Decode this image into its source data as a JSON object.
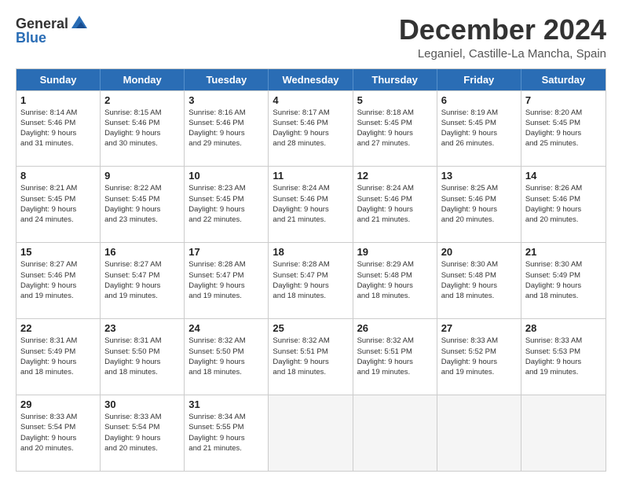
{
  "logo": {
    "general": "General",
    "blue": "Blue"
  },
  "title": "December 2024",
  "location": "Leganiel, Castille-La Mancha, Spain",
  "weekdays": [
    "Sunday",
    "Monday",
    "Tuesday",
    "Wednesday",
    "Thursday",
    "Friday",
    "Saturday"
  ],
  "weeks": [
    [
      {
        "day": "1",
        "info": "Sunrise: 8:14 AM\nSunset: 5:46 PM\nDaylight: 9 hours\nand 31 minutes."
      },
      {
        "day": "2",
        "info": "Sunrise: 8:15 AM\nSunset: 5:46 PM\nDaylight: 9 hours\nand 30 minutes."
      },
      {
        "day": "3",
        "info": "Sunrise: 8:16 AM\nSunset: 5:46 PM\nDaylight: 9 hours\nand 29 minutes."
      },
      {
        "day": "4",
        "info": "Sunrise: 8:17 AM\nSunset: 5:46 PM\nDaylight: 9 hours\nand 28 minutes."
      },
      {
        "day": "5",
        "info": "Sunrise: 8:18 AM\nSunset: 5:45 PM\nDaylight: 9 hours\nand 27 minutes."
      },
      {
        "day": "6",
        "info": "Sunrise: 8:19 AM\nSunset: 5:45 PM\nDaylight: 9 hours\nand 26 minutes."
      },
      {
        "day": "7",
        "info": "Sunrise: 8:20 AM\nSunset: 5:45 PM\nDaylight: 9 hours\nand 25 minutes."
      }
    ],
    [
      {
        "day": "8",
        "info": "Sunrise: 8:21 AM\nSunset: 5:45 PM\nDaylight: 9 hours\nand 24 minutes."
      },
      {
        "day": "9",
        "info": "Sunrise: 8:22 AM\nSunset: 5:45 PM\nDaylight: 9 hours\nand 23 minutes."
      },
      {
        "day": "10",
        "info": "Sunrise: 8:23 AM\nSunset: 5:45 PM\nDaylight: 9 hours\nand 22 minutes."
      },
      {
        "day": "11",
        "info": "Sunrise: 8:24 AM\nSunset: 5:46 PM\nDaylight: 9 hours\nand 21 minutes."
      },
      {
        "day": "12",
        "info": "Sunrise: 8:24 AM\nSunset: 5:46 PM\nDaylight: 9 hours\nand 21 minutes."
      },
      {
        "day": "13",
        "info": "Sunrise: 8:25 AM\nSunset: 5:46 PM\nDaylight: 9 hours\nand 20 minutes."
      },
      {
        "day": "14",
        "info": "Sunrise: 8:26 AM\nSunset: 5:46 PM\nDaylight: 9 hours\nand 20 minutes."
      }
    ],
    [
      {
        "day": "15",
        "info": "Sunrise: 8:27 AM\nSunset: 5:46 PM\nDaylight: 9 hours\nand 19 minutes."
      },
      {
        "day": "16",
        "info": "Sunrise: 8:27 AM\nSunset: 5:47 PM\nDaylight: 9 hours\nand 19 minutes."
      },
      {
        "day": "17",
        "info": "Sunrise: 8:28 AM\nSunset: 5:47 PM\nDaylight: 9 hours\nand 19 minutes."
      },
      {
        "day": "18",
        "info": "Sunrise: 8:28 AM\nSunset: 5:47 PM\nDaylight: 9 hours\nand 18 minutes."
      },
      {
        "day": "19",
        "info": "Sunrise: 8:29 AM\nSunset: 5:48 PM\nDaylight: 9 hours\nand 18 minutes."
      },
      {
        "day": "20",
        "info": "Sunrise: 8:30 AM\nSunset: 5:48 PM\nDaylight: 9 hours\nand 18 minutes."
      },
      {
        "day": "21",
        "info": "Sunrise: 8:30 AM\nSunset: 5:49 PM\nDaylight: 9 hours\nand 18 minutes."
      }
    ],
    [
      {
        "day": "22",
        "info": "Sunrise: 8:31 AM\nSunset: 5:49 PM\nDaylight: 9 hours\nand 18 minutes."
      },
      {
        "day": "23",
        "info": "Sunrise: 8:31 AM\nSunset: 5:50 PM\nDaylight: 9 hours\nand 18 minutes."
      },
      {
        "day": "24",
        "info": "Sunrise: 8:32 AM\nSunset: 5:50 PM\nDaylight: 9 hours\nand 18 minutes."
      },
      {
        "day": "25",
        "info": "Sunrise: 8:32 AM\nSunset: 5:51 PM\nDaylight: 9 hours\nand 18 minutes."
      },
      {
        "day": "26",
        "info": "Sunrise: 8:32 AM\nSunset: 5:51 PM\nDaylight: 9 hours\nand 19 minutes."
      },
      {
        "day": "27",
        "info": "Sunrise: 8:33 AM\nSunset: 5:52 PM\nDaylight: 9 hours\nand 19 minutes."
      },
      {
        "day": "28",
        "info": "Sunrise: 8:33 AM\nSunset: 5:53 PM\nDaylight: 9 hours\nand 19 minutes."
      }
    ],
    [
      {
        "day": "29",
        "info": "Sunrise: 8:33 AM\nSunset: 5:54 PM\nDaylight: 9 hours\nand 20 minutes."
      },
      {
        "day": "30",
        "info": "Sunrise: 8:33 AM\nSunset: 5:54 PM\nDaylight: 9 hours\nand 20 minutes."
      },
      {
        "day": "31",
        "info": "Sunrise: 8:34 AM\nSunset: 5:55 PM\nDaylight: 9 hours\nand 21 minutes."
      },
      {
        "day": "",
        "info": ""
      },
      {
        "day": "",
        "info": ""
      },
      {
        "day": "",
        "info": ""
      },
      {
        "day": "",
        "info": ""
      }
    ]
  ]
}
